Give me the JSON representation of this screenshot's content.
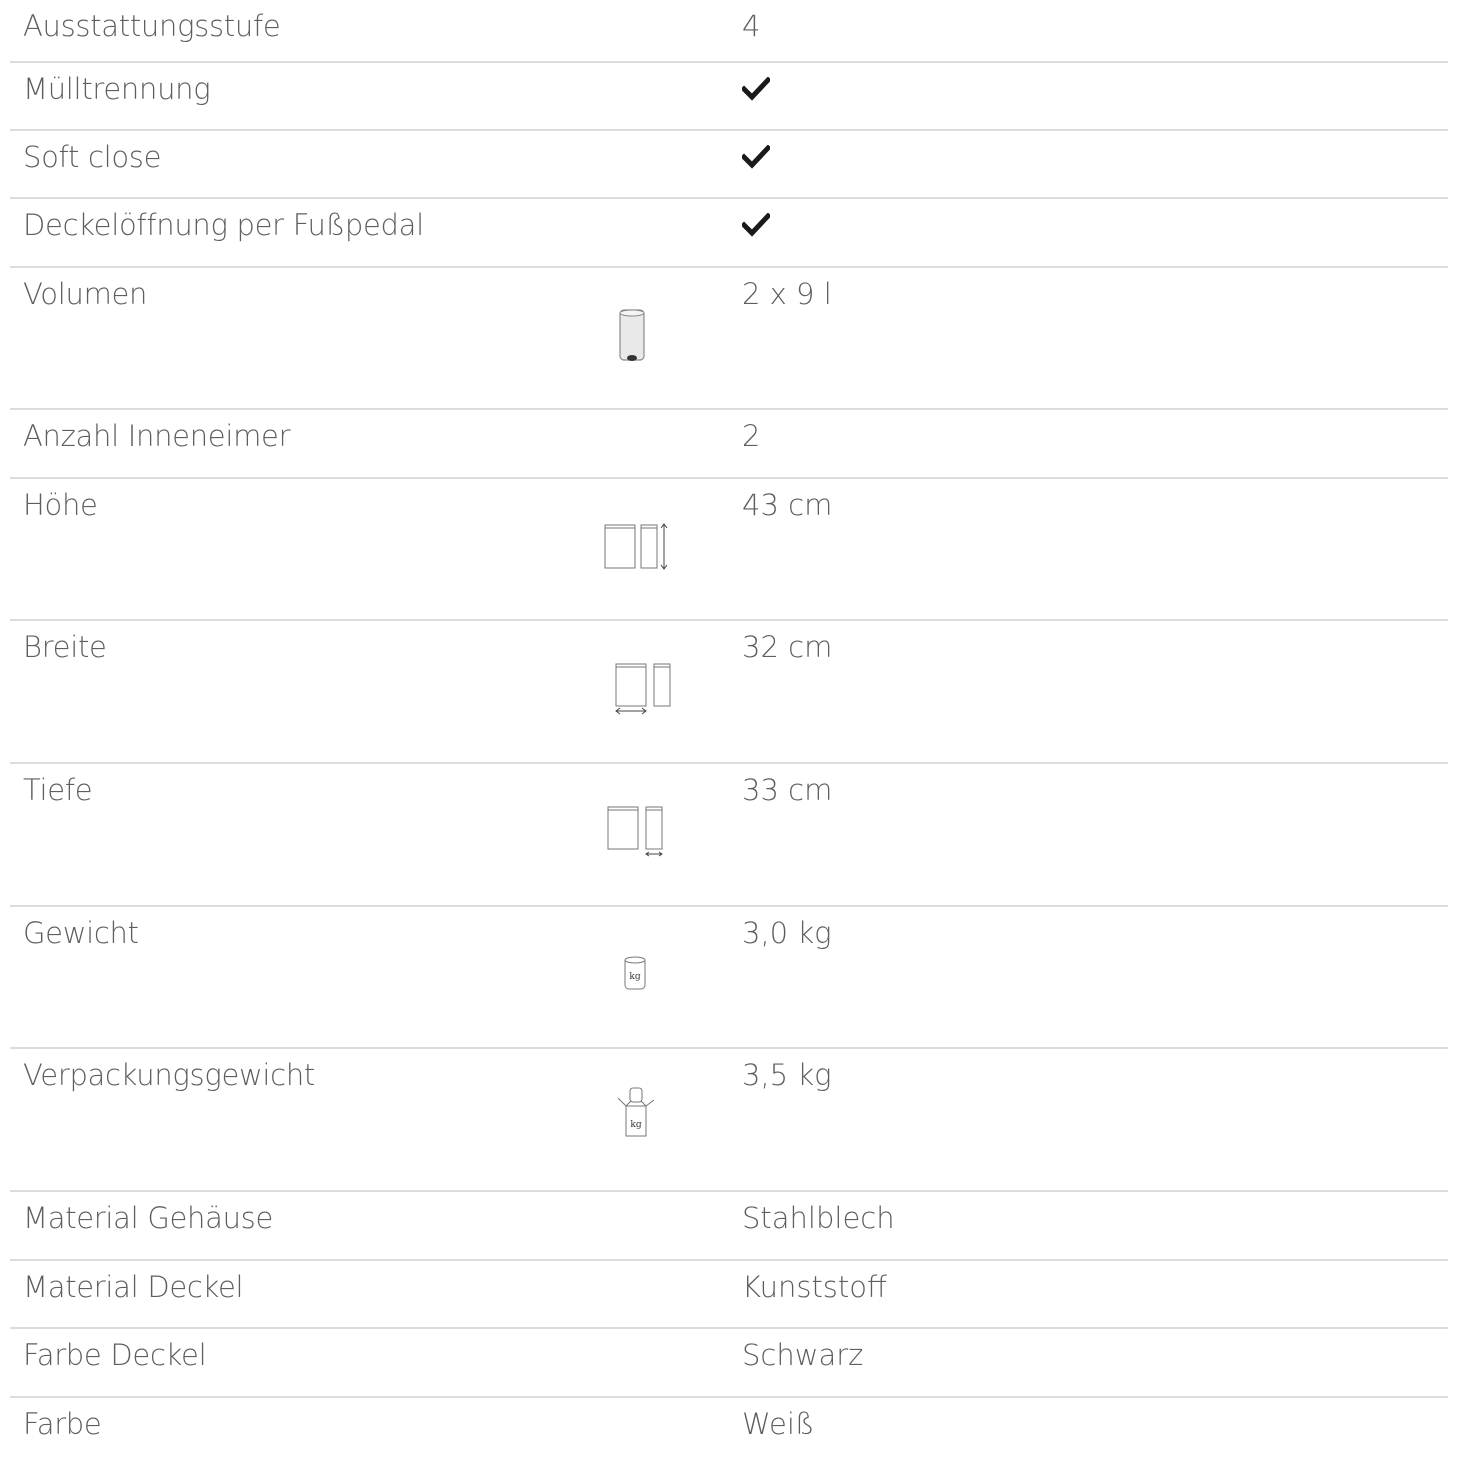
{
  "rows": [
    {
      "label": "Ausstattungsstufe",
      "value": "4"
    },
    {
      "label": "Mülltrennung",
      "value": "",
      "check": true
    },
    {
      "label": "Soft close",
      "value": "",
      "check": true
    },
    {
      "label": "Deckelöffnung per Fußpedal",
      "value": "",
      "check": true
    },
    {
      "label": "Volumen",
      "value": "2 x 9 l",
      "icon": "bin-volume-icon"
    },
    {
      "label": "Anzahl Inneneimer",
      "value": "2"
    },
    {
      "label": "Höhe",
      "value": "43 cm",
      "icon": "height-dimension-icon"
    },
    {
      "label": "Breite",
      "value": "32 cm",
      "icon": "width-dimension-icon"
    },
    {
      "label": "Tiefe",
      "value": "33 cm",
      "icon": "depth-dimension-icon"
    },
    {
      "label": "Gewicht",
      "value": "3,0 kg",
      "icon": "weight-icon",
      "icon_text": "kg"
    },
    {
      "label": "Verpackungsgewicht",
      "value": "3,5 kg",
      "icon": "package-weight-icon",
      "icon_text": "kg"
    },
    {
      "label": "Material Gehäuse",
      "value": "Stahlblech"
    },
    {
      "label": "Material Deckel",
      "value": "Kunststoff"
    },
    {
      "label": "Farbe Deckel",
      "value": "Schwarz"
    },
    {
      "label": "Farbe",
      "value": "Weiß"
    }
  ]
}
